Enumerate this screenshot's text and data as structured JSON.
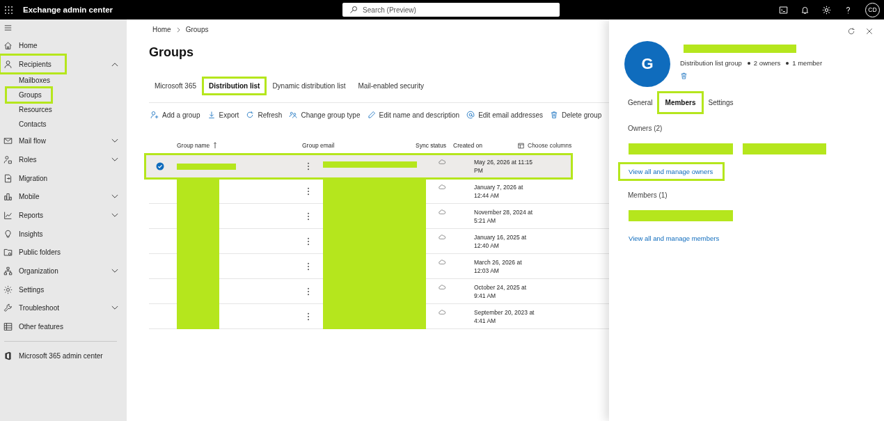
{
  "top_bar": {
    "app_title": "Exchange admin center",
    "search": {
      "placeholder": "Search (Preview)"
    },
    "avatar": "CD"
  },
  "sidebar": {
    "items": [
      {
        "label": "Home"
      },
      {
        "label": "Recipients",
        "expanded": true,
        "highlighted": true,
        "children": [
          {
            "label": "Mailboxes",
            "highlighted": false
          },
          {
            "label": "Groups",
            "highlighted": true
          },
          {
            "label": "Resources",
            "highlighted": false
          },
          {
            "label": "Contacts",
            "highlighted": false
          }
        ]
      },
      {
        "label": "Mail flow",
        "expanded": false
      },
      {
        "label": "Roles",
        "expanded": false
      },
      {
        "label": "Migration"
      },
      {
        "label": "Mobile",
        "expanded": false
      },
      {
        "label": "Reports",
        "expanded": false
      },
      {
        "label": "Insights"
      },
      {
        "label": "Public folders"
      },
      {
        "label": "Organization",
        "expanded": false
      },
      {
        "label": "Settings"
      },
      {
        "label": "Troubleshoot",
        "expanded": false
      },
      {
        "label": "Other features"
      }
    ],
    "footer_item": {
      "label": "Microsoft 365 admin center"
    }
  },
  "breadcrumb": [
    "Home",
    "Groups"
  ],
  "page_title": "Groups",
  "tabs": [
    {
      "label": "Microsoft 365",
      "selected": false,
      "highlighted": false
    },
    {
      "label": "Distribution list",
      "selected": true,
      "highlighted": true
    },
    {
      "label": "Dynamic distribution list",
      "selected": false,
      "highlighted": false
    },
    {
      "label": "Mail-enabled security",
      "selected": false,
      "highlighted": false
    }
  ],
  "toolbar": [
    "Add a group",
    "Export",
    "Refresh",
    "Change group type",
    "Edit name and description",
    "Edit email addresses",
    "Delete group"
  ],
  "table": {
    "columns": [
      "Group name",
      "Group email",
      "Sync status",
      "Created on"
    ],
    "choose_columns": "Choose columns",
    "rows": [
      {
        "selected": true,
        "highlighted": true,
        "redacted": true,
        "created": "May 26, 2026 at 11:15 PM"
      },
      {
        "selected": false,
        "highlighted": false,
        "redacted": true,
        "created": "January 7, 2026 at 12:44 AM"
      },
      {
        "selected": false,
        "highlighted": false,
        "redacted": true,
        "created": "November 28, 2024 at 5:21 AM"
      },
      {
        "selected": false,
        "highlighted": false,
        "redacted": true,
        "created": "January 16, 2025 at 12:40 AM"
      },
      {
        "selected": false,
        "highlighted": false,
        "redacted": true,
        "created": "March 26, 2026 at 12:03 AM"
      },
      {
        "selected": false,
        "highlighted": false,
        "redacted": true,
        "created": "October 24, 2025 at 9:41 AM"
      },
      {
        "selected": false,
        "highlighted": false,
        "redacted": true,
        "created": "September 20, 2023 at 4:41 AM"
      }
    ]
  },
  "panel": {
    "avatar": "G",
    "title_redacted": true,
    "subtitle": [
      "Distribution list group",
      "2 owners",
      "1 member"
    ],
    "tabs": [
      {
        "label": "General",
        "selected": false,
        "highlighted": false
      },
      {
        "label": "Members",
        "selected": true,
        "highlighted": true
      },
      {
        "label": "Settings",
        "selected": false,
        "highlighted": false
      }
    ],
    "owners": {
      "heading": "Owners (2)",
      "people": [
        {
          "redacted": true
        },
        {
          "redacted": true
        }
      ],
      "link": "View all and manage owners",
      "link_highlighted": true
    },
    "members": {
      "heading": "Members (1)",
      "people": [
        {
          "redacted": true
        }
      ],
      "link": "View all and manage members",
      "link_highlighted": false
    }
  }
}
